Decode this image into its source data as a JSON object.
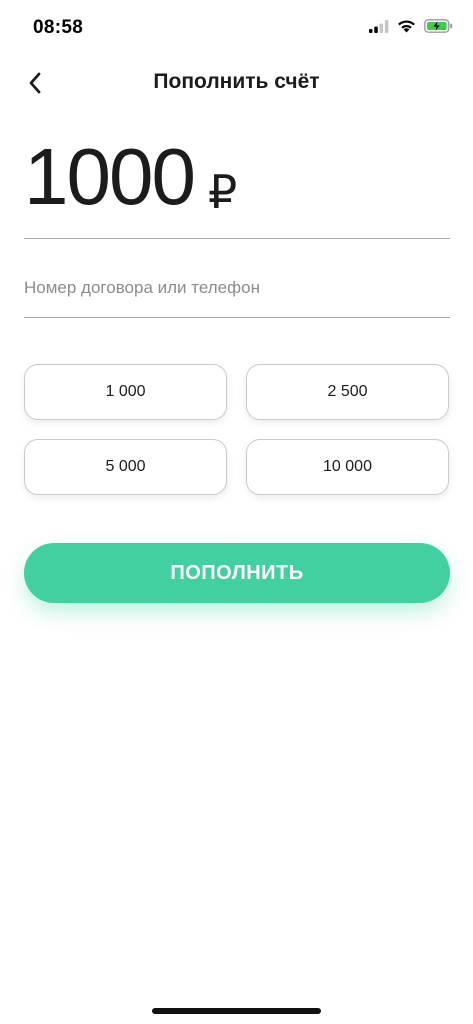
{
  "status_bar": {
    "time": "08:58",
    "icons": [
      "cellular-signal-icon",
      "wifi-icon",
      "battery-charging-icon"
    ],
    "battery_color": "#43c94e"
  },
  "nav": {
    "title": "Пополнить счёт",
    "back_icon": "chevron-left-icon"
  },
  "amount": {
    "value": "1000",
    "currency": "₽"
  },
  "contract": {
    "placeholder": "Номер договора или телефон",
    "value": ""
  },
  "presets": [
    {
      "label": "1 000"
    },
    {
      "label": "2 500"
    },
    {
      "label": "5 000"
    },
    {
      "label": "10 000"
    }
  ],
  "submit": {
    "label": "ПОПОЛНИТЬ",
    "color": "#43d0a0"
  }
}
